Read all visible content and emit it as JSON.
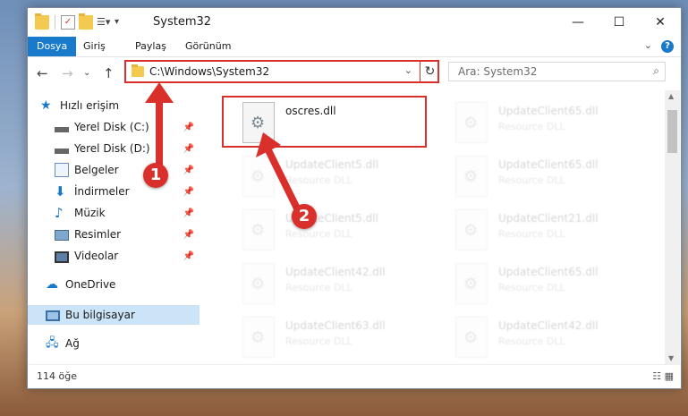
{
  "window": {
    "title": "System32"
  },
  "ribbon": {
    "tabs": [
      "Dosya",
      "Giriş",
      "Paylaş",
      "Görünüm"
    ],
    "help": "?"
  },
  "address": {
    "path": "C:\\Windows\\System32"
  },
  "search": {
    "placeholder": "Ara: System32"
  },
  "nav": {
    "quick_access": "Hızlı erişim",
    "items": [
      "Yerel Disk (C:)",
      "Yerel Disk (D:)",
      "Belgeler",
      "İndirmeler",
      "Müzik",
      "Resimler",
      "Videolar"
    ],
    "onedrive": "OneDrive",
    "this_pc": "Bu bilgisayar",
    "network": "Ağ"
  },
  "files": [
    {
      "name": "oscres.dll",
      "type": ""
    },
    {
      "name": "UpdateClient65.dll",
      "type": "Resource DLL"
    },
    {
      "name": "UpdateClient5.dll",
      "type": "Resource DLL"
    },
    {
      "name": "UpdateClient65.dll",
      "type": "Resource DLL"
    },
    {
      "name": "UpdateClient5.dll",
      "type": "Resource DLL"
    },
    {
      "name": "UpdateClient21.dll",
      "type": "Resource DLL"
    },
    {
      "name": "UpdateClient42.dll",
      "type": "Resource DLL"
    },
    {
      "name": "UpdateClient65.dll",
      "type": "Resource DLL"
    },
    {
      "name": "UpdateClient63.dll",
      "type": "Resource DLL"
    },
    {
      "name": "UpdateClient42.dll",
      "type": "Resource DLL"
    }
  ],
  "status": {
    "count": "114 öğe"
  },
  "callouts": [
    "1",
    "2"
  ],
  "colors": {
    "accent": "#1979ca",
    "highlight": "#d9302c"
  }
}
